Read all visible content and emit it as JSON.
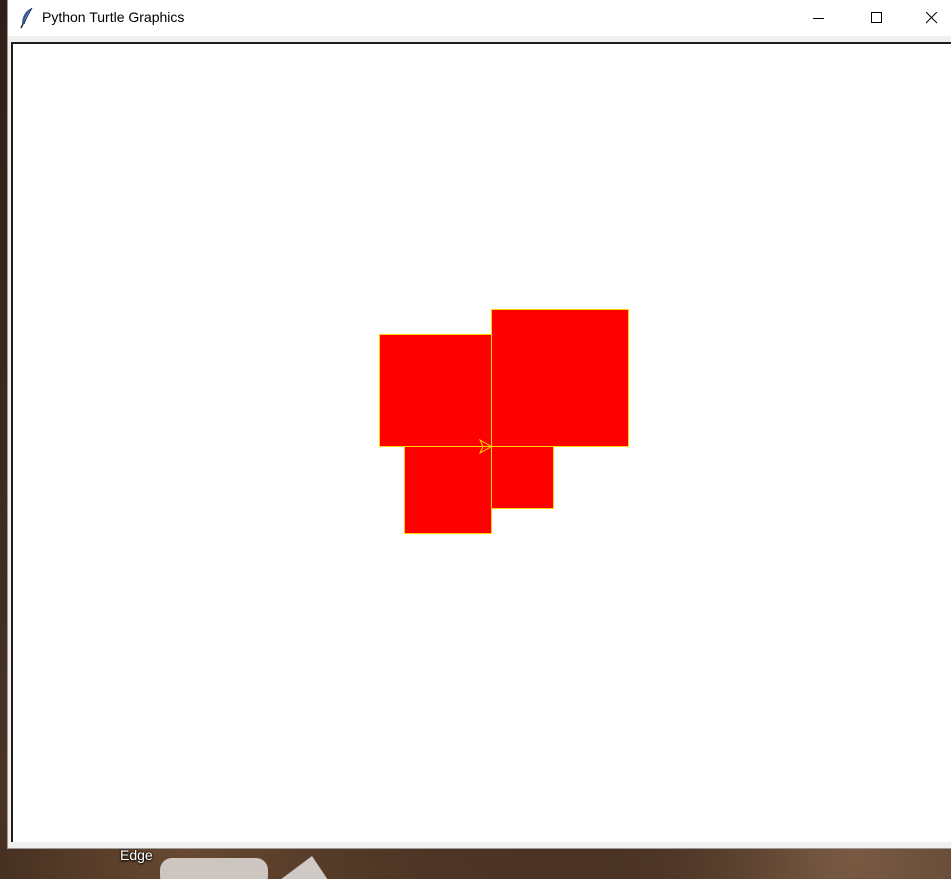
{
  "window": {
    "title": "Python Turtle Graphics",
    "buttons": {
      "minimize": "minimize-icon",
      "maximize": "maximize-icon",
      "close": "close-icon"
    }
  },
  "canvas": {
    "background": "#ffffff",
    "fill_color": "#ff0000",
    "pen_color": "#ffd700"
  },
  "desktop": {
    "label": "Edge"
  }
}
